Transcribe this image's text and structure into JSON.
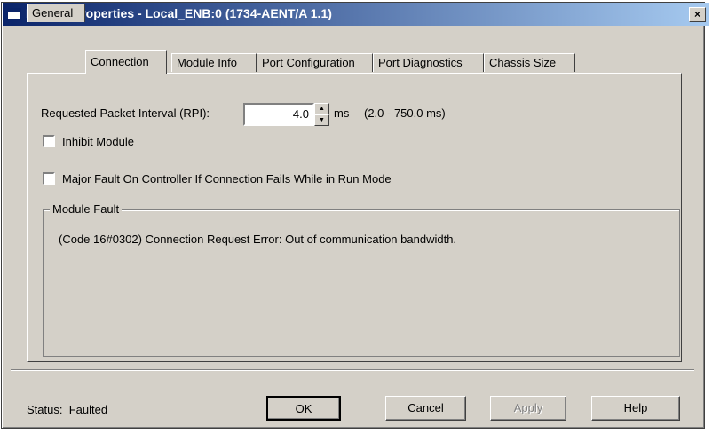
{
  "window": {
    "title": "Module Properties - Local_ENB:0 (1734-AENT/A 1.1)",
    "close_glyph": "×"
  },
  "tabs": [
    {
      "label": "General",
      "active": false
    },
    {
      "label": "Connection",
      "active": true
    },
    {
      "label": "Module Info",
      "active": false
    },
    {
      "label": "Port Configuration",
      "active": false
    },
    {
      "label": "Port Diagnostics",
      "active": false
    },
    {
      "label": "Chassis Size",
      "active": false
    }
  ],
  "connection": {
    "rpi_label": "Requested Packet Interval (RPI):",
    "rpi_value": "4.0",
    "rpi_unit": "ms",
    "rpi_range": "(2.0 - 750.0 ms)",
    "inhibit_label": "Inhibit Module",
    "inhibit_checked": false,
    "major_fault_label": "Major Fault On Controller If Connection Fails While in Run Mode",
    "major_fault_checked": false,
    "module_fault_title": "Module Fault",
    "module_fault_text": "(Code 16#0302) Connection Request Error: Out of communication bandwidth."
  },
  "status": {
    "label": "Status:",
    "value": "Faulted"
  },
  "buttons": {
    "ok": "OK",
    "cancel": "Cancel",
    "apply": "Apply",
    "help": "Help"
  }
}
